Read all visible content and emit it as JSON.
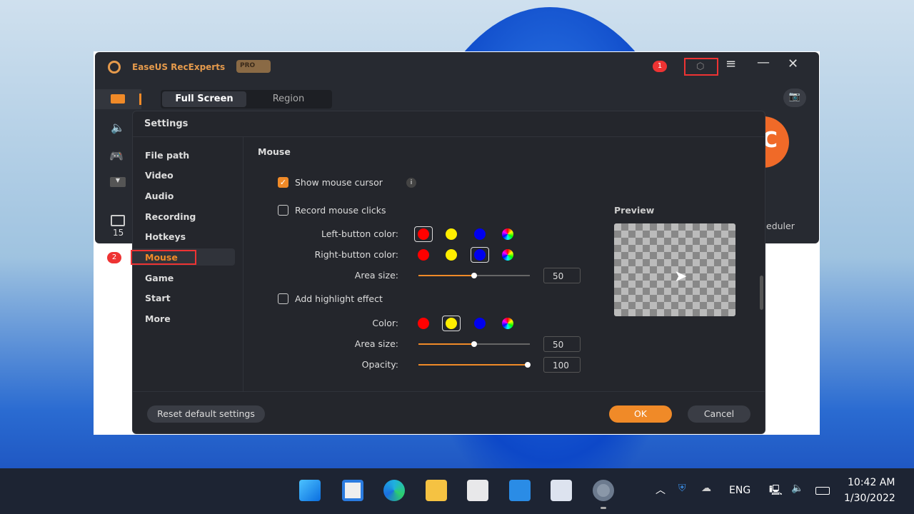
{
  "app": {
    "title": "EaseUS RecExperts",
    "pro_badge": "PRO",
    "tabs": [
      "Full Screen",
      "Region"
    ],
    "side_count": "15",
    "scheduler_partial": "eduler",
    "record_partial": "C",
    "annotation_1": "1",
    "annotation_2": "2"
  },
  "settings": {
    "title": "Settings",
    "nav": [
      "File path",
      "Video",
      "Audio",
      "Recording",
      "Hotkeys",
      "Mouse",
      "Game",
      "Start",
      "More"
    ],
    "active_nav": "Mouse",
    "section": "Mouse",
    "show_cursor": {
      "label": "Show mouse cursor",
      "checked": true
    },
    "record_clicks": {
      "label": "Record mouse clicks",
      "checked": false
    },
    "left_color_label": "Left-button color:",
    "right_color_label": "Right-button color:",
    "colors": [
      "#ff0000",
      "#ffee00",
      "#0000ee",
      "rainbow"
    ],
    "left_selected": "#ff0000",
    "right_selected": "#0000ee",
    "area_size_label": "Area size:",
    "click_area_size": "50",
    "highlight": {
      "label": "Add highlight effect",
      "checked": false,
      "color_label": "Color:",
      "selected": "#ffee00",
      "area_size_label": "Area size:",
      "area_size": "50",
      "opacity_label": "Opacity:",
      "opacity": "100"
    },
    "preview_label": "Preview",
    "reset": "Reset default settings",
    "ok": "OK",
    "cancel": "Cancel"
  },
  "taskbar": {
    "lang": "ENG",
    "time": "10:42 AM",
    "date": "1/30/2022"
  },
  "accent": "#f08a28"
}
